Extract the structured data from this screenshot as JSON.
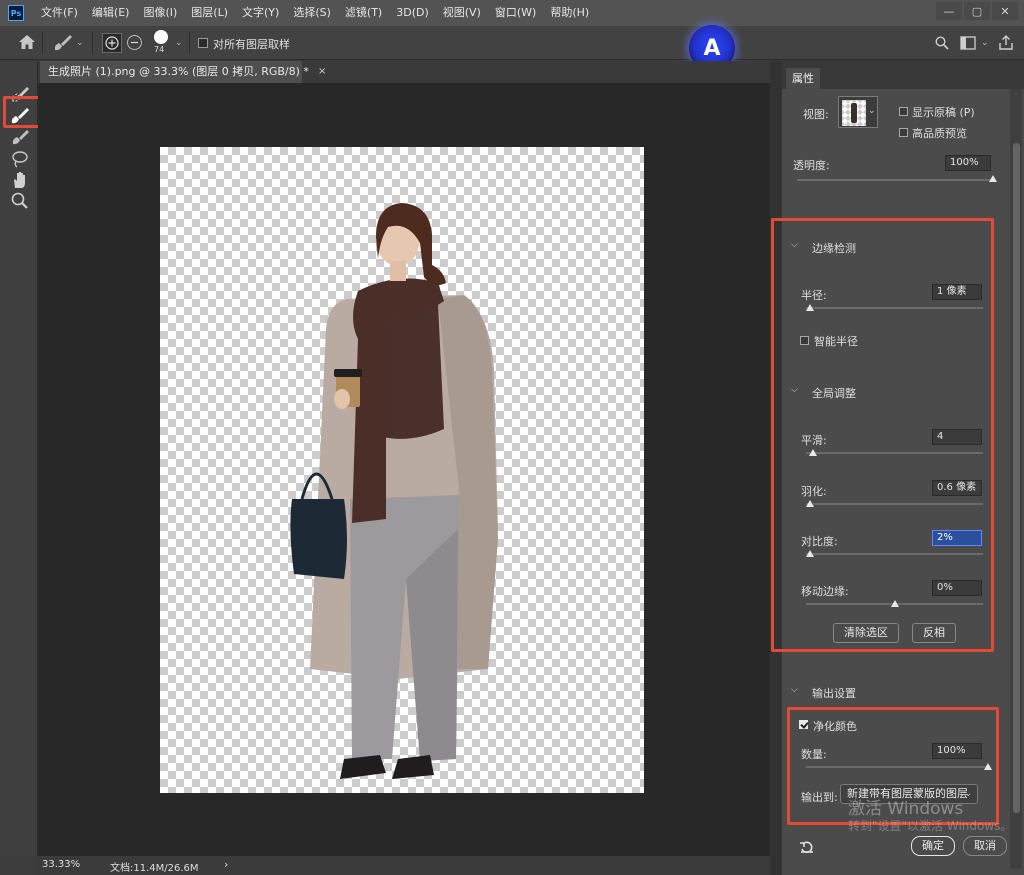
{
  "app": {
    "logo": "Ps",
    "menu": [
      "文件(F)",
      "编辑(E)",
      "图像(I)",
      "图层(L)",
      "文字(Y)",
      "选择(S)",
      "滤镜(T)",
      "3D(D)",
      "视图(V)",
      "窗口(W)",
      "帮助(H)"
    ],
    "window_controls": [
      "—",
      "▢",
      "✕"
    ]
  },
  "options_bar": {
    "brush_size": "74",
    "sample_all_layers": "对所有图层取样",
    "badge_letter": "A"
  },
  "document": {
    "tab_title": "生成照片 (1).png @ 33.3% (图层 0 拷贝, RGB/8) *",
    "close": "×"
  },
  "status": {
    "zoom": "33.33%",
    "doc_size": "文档:11.4M/26.6M",
    "arrow": "›"
  },
  "properties": {
    "tab": "属性",
    "view_label": "视图:",
    "show_original": "显示原稿 (P)",
    "high_quality": "高品质预览",
    "opacity_label": "透明度:",
    "opacity_value": "100%",
    "opacity_level": 1.0,
    "edge_detection": {
      "title": "边缘检测",
      "radius_label": "半径:",
      "radius_value": "1 像素",
      "radius_level": 0.02,
      "smart_radius": "智能半径"
    },
    "global_refine": {
      "title": "全局调整",
      "smooth_label": "平滑:",
      "smooth_value": "4",
      "smooth_level": 0.04,
      "feather_label": "羽化:",
      "feather_value": "0.6 像素",
      "feather_level": 0.02,
      "contrast_label": "对比度:",
      "contrast_value": "2%",
      "contrast_level": 0.02,
      "shift_edge_label": "移动边缘:",
      "shift_edge_value": "0%",
      "shift_edge_level": 0.5,
      "clear_selection": "清除选区",
      "invert": "反相"
    },
    "output": {
      "title": "输出设置",
      "decontaminate": "净化颜色",
      "decontaminate_checked": true,
      "amount_label": "数量:",
      "amount_value": "100%",
      "amount_level": 1.0,
      "output_to_label": "输出到:",
      "output_to_value": "新建带有图层蒙版的图层"
    },
    "ok": "确定",
    "cancel": "取消"
  },
  "watermark": {
    "line1": "激活 Windows",
    "line2": "转到\"设置\"以激活 Windows。"
  },
  "colors": {
    "highlight": "#e24a36",
    "selection": "#2b4f9a"
  }
}
